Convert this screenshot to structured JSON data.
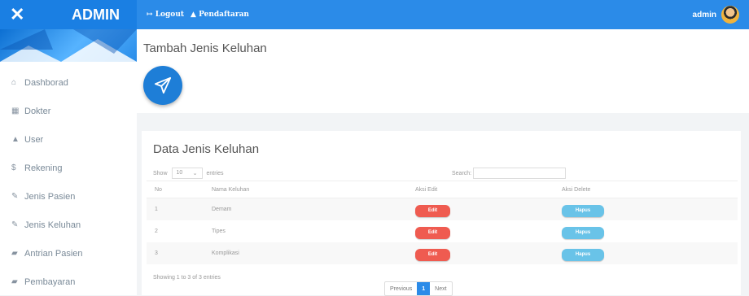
{
  "header": {
    "title": "ADMIN",
    "logout": "Logout",
    "register": "Pendaftaran",
    "user": "admin"
  },
  "sidebar": {
    "items": [
      {
        "label": "Dashborad",
        "icon": "home-icon"
      },
      {
        "label": "Dokter",
        "icon": "doctor-icon"
      },
      {
        "label": "User",
        "icon": "user-icon"
      },
      {
        "label": "Rekening",
        "icon": "dollar-icon"
      },
      {
        "label": "Jenis Pasien",
        "icon": "edit-icon"
      },
      {
        "label": "Jenis Keluhan",
        "icon": "edit-icon"
      },
      {
        "label": "Antrian Pasien",
        "icon": "group-icon"
      },
      {
        "label": "Pembayaran",
        "icon": "group-icon"
      }
    ]
  },
  "page": {
    "heading": "Tambah Jenis Keluhan"
  },
  "table_card": {
    "heading": "Data Jenis Keluhan",
    "show_label": "Show",
    "entries_value": "10",
    "entries_label": "entries",
    "search_label": "Search:",
    "columns": [
      "No",
      "Nama Keluhan",
      "Aksi Edit",
      "Aksi Delete"
    ],
    "rows": [
      {
        "no": "1",
        "name": "Demam",
        "edit": "Edit",
        "delete": "Hapus"
      },
      {
        "no": "2",
        "name": "Tipes",
        "edit": "Edit",
        "delete": "Hapus"
      },
      {
        "no": "3",
        "name": "Komplikasi",
        "edit": "Edit",
        "delete": "Hapus"
      }
    ],
    "info": "Showing 1 to 3 of 3 entries",
    "pagination": {
      "previous": "Previous",
      "current": "1",
      "next": "Next"
    }
  },
  "colors": {
    "primary": "#2b8be8",
    "edit": "#ef5b50",
    "delete": "#69c3e8"
  }
}
